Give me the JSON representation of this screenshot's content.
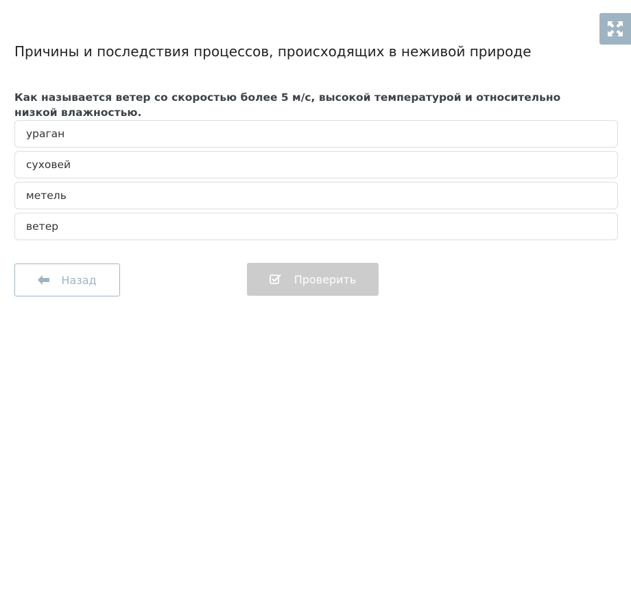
{
  "header": {
    "title": "Причины и последствия процессов, происходящих в неживой природе",
    "fullscreen_icon": "expand-icon"
  },
  "quiz": {
    "question": "Как называется ветер со скоростью более 5 м/с, высокой температурой и относительно низкой влажностью.",
    "options": [
      {
        "label": "ураган"
      },
      {
        "label": "суховей"
      },
      {
        "label": "метель"
      },
      {
        "label": "ветер"
      }
    ]
  },
  "actions": {
    "back_label": "Назад",
    "back_icon": "arrow-left-icon",
    "check_label": "Проверить",
    "check_icon": "checkbox-check-icon"
  },
  "colors": {
    "accent": "#9fb4c2",
    "disabled_button": "#cccccc"
  }
}
